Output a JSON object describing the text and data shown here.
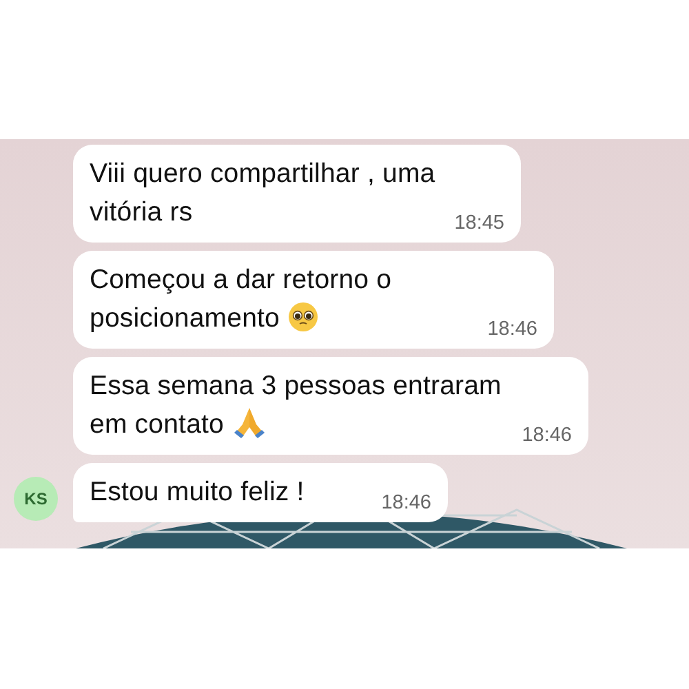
{
  "messages": [
    {
      "kind": "plain",
      "text": "Viii quero compartilhar , uma vitória rs",
      "time": "18:45"
    },
    {
      "kind": "face",
      "text": "Começou a dar retorno o posicionamento",
      "time": "18:46"
    },
    {
      "kind": "hands",
      "text": "Essa semana 3 pessoas entraram em contato",
      "time": "18:46"
    },
    {
      "kind": "plain",
      "text": "Estou muito feliz !",
      "time": "18:46",
      "avatar": "KS"
    }
  ]
}
